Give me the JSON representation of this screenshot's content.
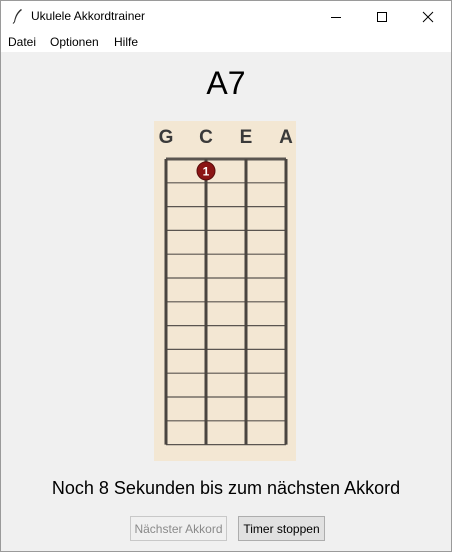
{
  "window": {
    "title": "Ukulele Akkordtrainer",
    "controls": {
      "minimize": "minimize",
      "maximize": "maximize",
      "close": "close"
    }
  },
  "menu": {
    "items": [
      {
        "label": "Datei"
      },
      {
        "label": "Optionen"
      },
      {
        "label": "Hilfe"
      }
    ]
  },
  "chord": {
    "name": "A7",
    "strings": [
      "G",
      "C",
      "E",
      "A"
    ],
    "frets_shown": 12,
    "fingers": [
      {
        "string": "C",
        "fret": 1,
        "finger": "1"
      }
    ],
    "colors": {
      "board": "#f3e7d3",
      "string": "#4a4540",
      "fret": "#5a5550",
      "finger_dot": "#8b1515"
    }
  },
  "status": {
    "message": "Noch 8 Sekunden bis zum nächsten Akkord"
  },
  "buttons": {
    "next_chord": {
      "label": "Nächster Akkord",
      "enabled": false
    },
    "stop_timer": {
      "label": "Timer stoppen",
      "enabled": true
    }
  }
}
